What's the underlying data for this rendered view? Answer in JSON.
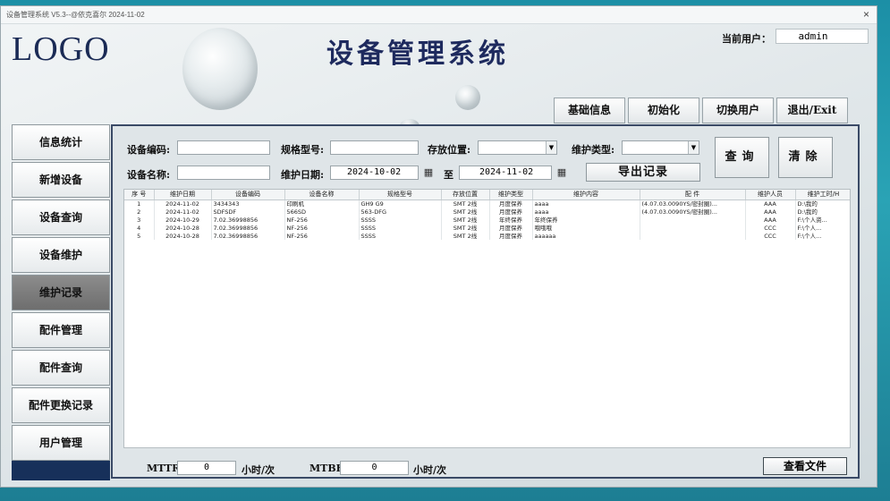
{
  "window": {
    "title": "设备管理系统 V5.3--@依克喜尔   2024-11-02",
    "close_icon": "×"
  },
  "header": {
    "logo": "LOGO",
    "app_title": "设备管理系统",
    "user_label": "当前用户：",
    "user_value": "admin"
  },
  "top_buttons": {
    "basic_info": "基础信息",
    "initialize": "初始化",
    "switch_user": "切换用户",
    "exit": "退出/Exit"
  },
  "sidebar": {
    "items": [
      {
        "label": "信息统计"
      },
      {
        "label": "新增设备"
      },
      {
        "label": "设备查询"
      },
      {
        "label": "设备维护"
      },
      {
        "label": "维护记录"
      },
      {
        "label": "配件管理"
      },
      {
        "label": "配件查询"
      },
      {
        "label": "配件更换记录"
      },
      {
        "label": "用户管理"
      }
    ],
    "active_index": 4
  },
  "filters": {
    "device_code_label": "设备编码:",
    "device_code_value": "",
    "spec_label": "规格型号:",
    "spec_value": "",
    "location_label": "存放位置:",
    "location_value": "",
    "maint_type_label": "维护类型:",
    "maint_type_value": "",
    "device_name_label": "设备名称:",
    "device_name_value": "",
    "maint_date_label": "维护日期:",
    "date_from": "2024-10-02",
    "date_to_label": "至",
    "date_to": "2024-11-02",
    "calendar_icon": "calendar-icon"
  },
  "actions": {
    "query": "查询",
    "clear": "清除",
    "export": "导出记录",
    "view_file": "查看文件"
  },
  "table": {
    "columns": [
      "序 号",
      "维护日期",
      "设备编码",
      "设备名称",
      "规格型号",
      "存放位置",
      "维护类型",
      "维护内容",
      "配 件",
      "维护人员",
      "维护工时/H"
    ],
    "rows": [
      [
        "1",
        "2024-11-02",
        "3434343",
        "印刷机",
        "GH9 G9",
        "SMT 2线",
        "月度保养",
        "aaaa",
        "(4.07.03.0090YS/密封圈)...",
        "AAA",
        "D:\\我的"
      ],
      [
        "2",
        "2024-11-02",
        "SDFSDF",
        "566SD",
        "563-DFG",
        "SMT 2线",
        "月度保养",
        "aaaa",
        "(4.07.03.0090YS/密封圈)...",
        "AAA",
        "D:\\我的"
      ],
      [
        "3",
        "2024-10-29",
        "7.02.36998856",
        "NF-256",
        "SSSS",
        "SMT 2线",
        "年终保养",
        "年终保养",
        "",
        "AAA",
        "F:\\个人资..."
      ],
      [
        "4",
        "2024-10-28",
        "7.02.36998856",
        "NF-256",
        "SSSS",
        "SMT 2线",
        "月度保养",
        "哦哦哦",
        "",
        "CCC",
        "F:\\个人..."
      ],
      [
        "5",
        "2024-10-28",
        "7.02.36998856",
        "NF-256",
        "SSSS",
        "SMT 2线",
        "月度保养",
        "aaaaaa",
        "",
        "CCC",
        "F:\\个人..."
      ]
    ]
  },
  "footer": {
    "mttr_label": "MTTR:",
    "mttr_value": "0",
    "mttr_unit": "小时/次",
    "mtbf_label": "MTBF:",
    "mtbf_value": "0",
    "mtbf_unit": "小时/次"
  }
}
